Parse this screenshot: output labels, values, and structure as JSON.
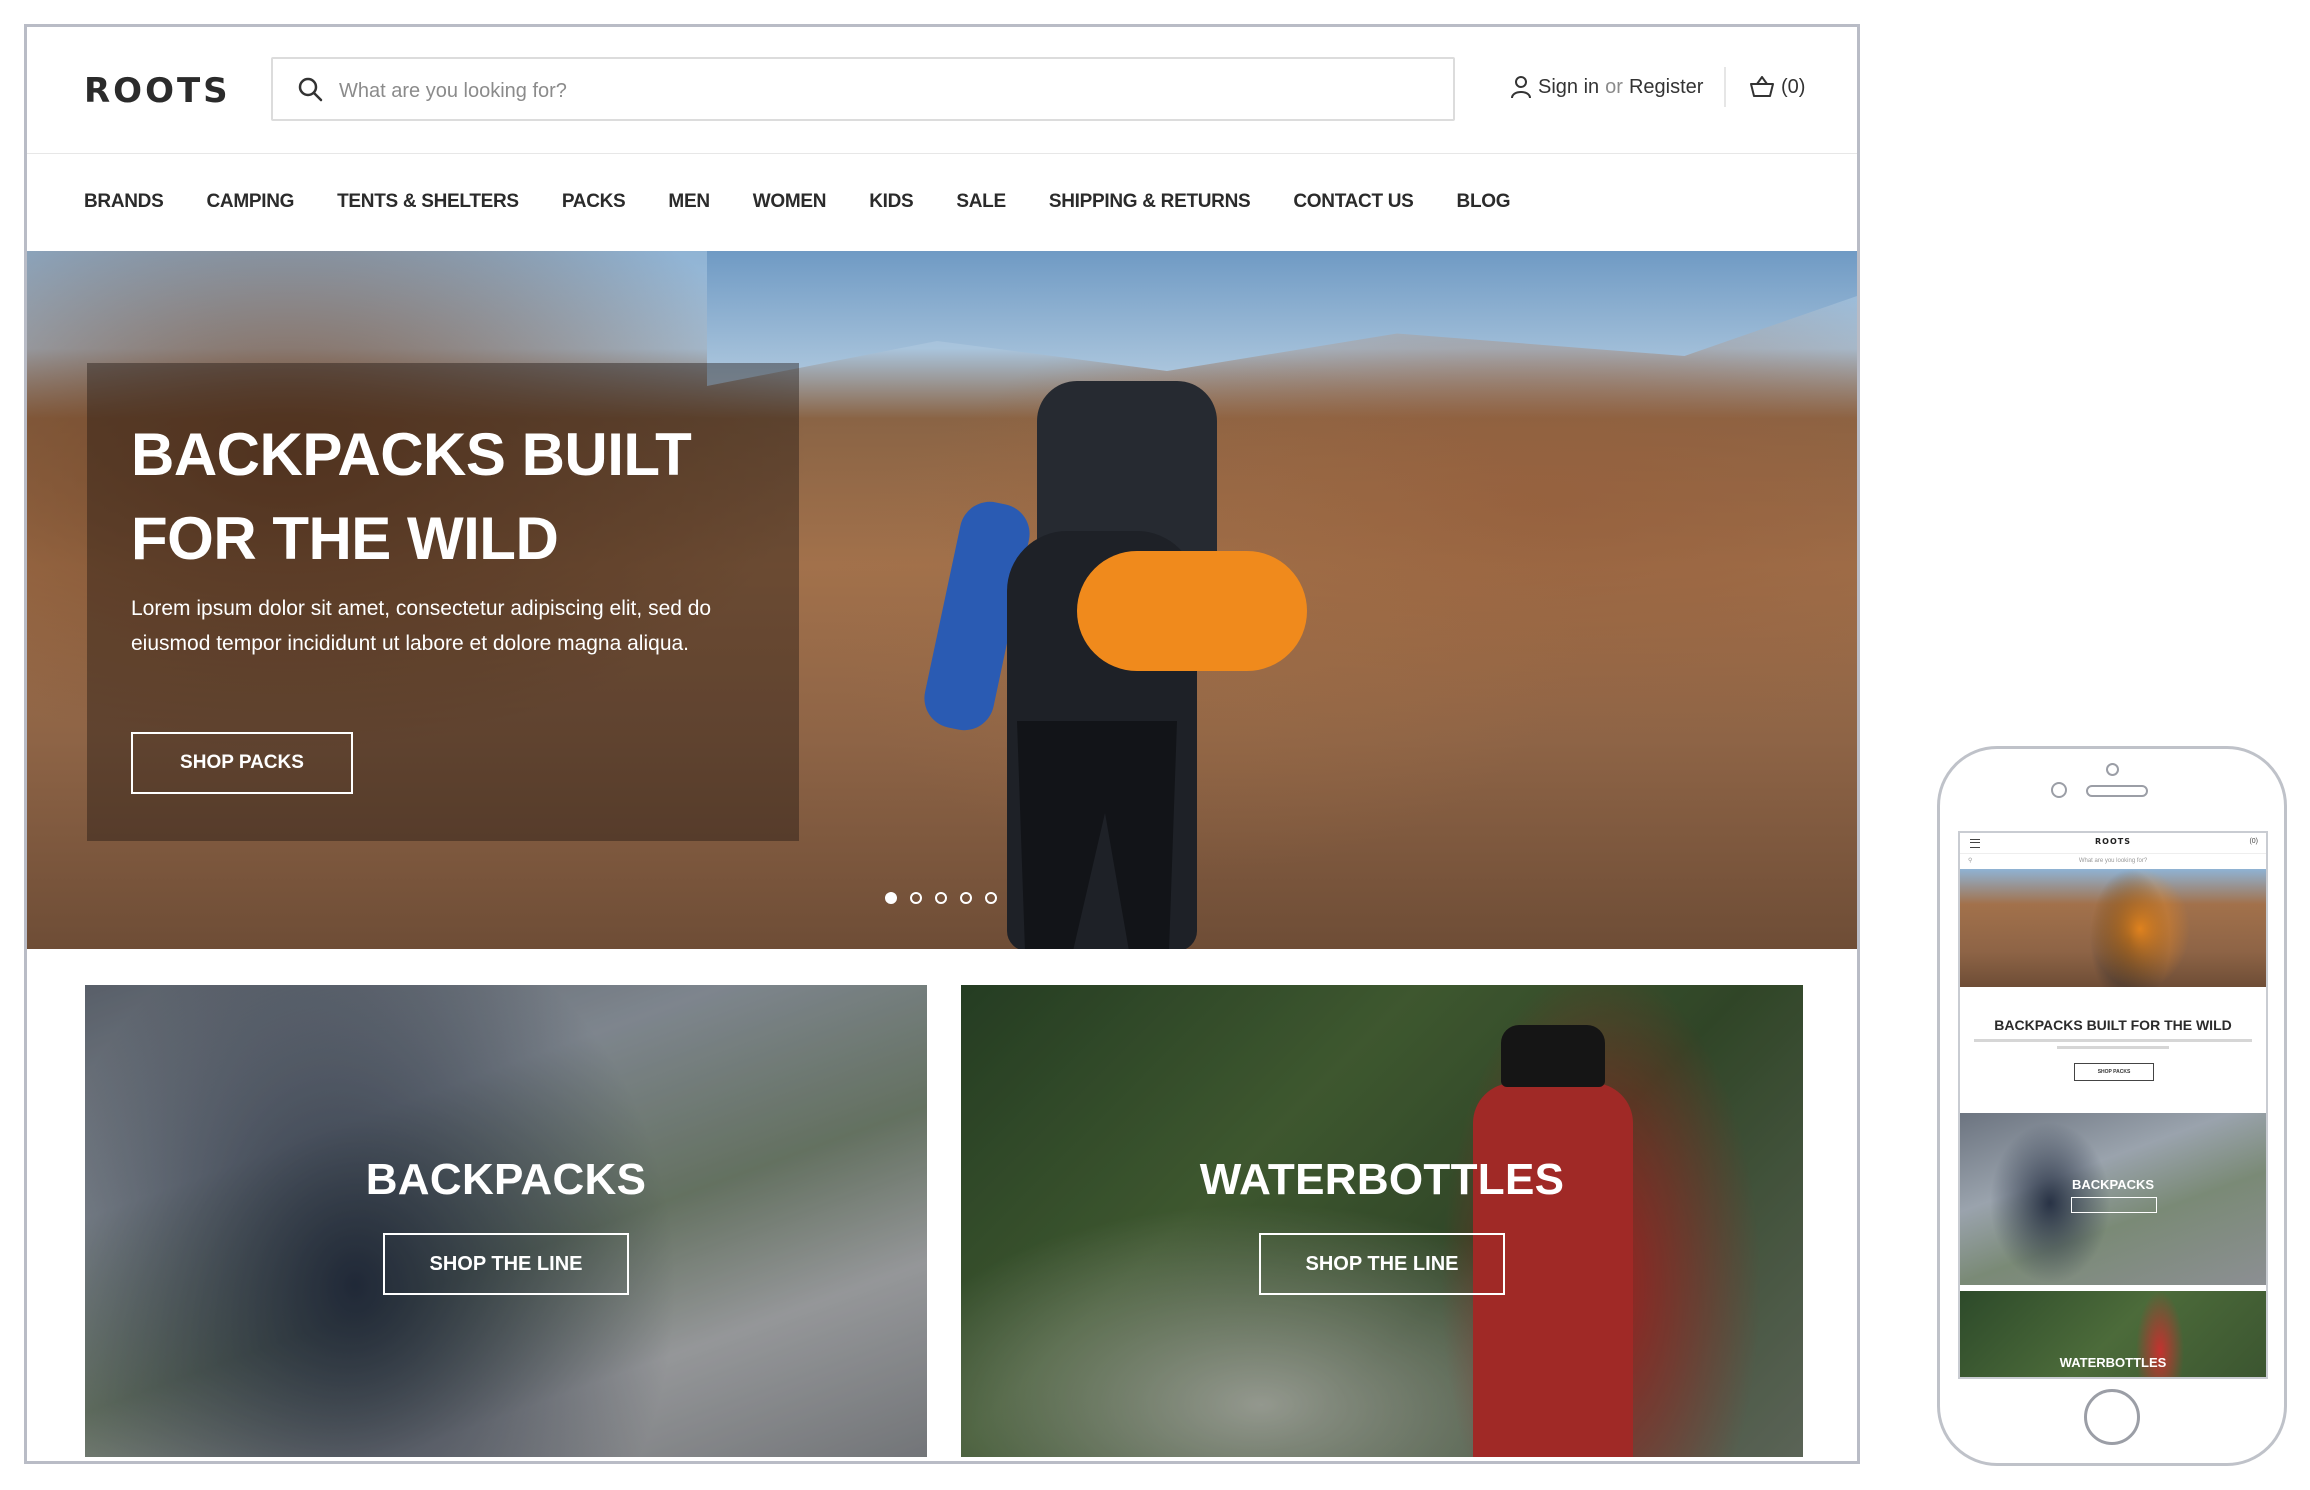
{
  "desktop": {
    "logo": "ROOTS",
    "search": {
      "placeholder": "What are you looking for?"
    },
    "account": {
      "sign_in": "Sign in",
      "or": "or",
      "register": "Register"
    },
    "cart": {
      "count": "(0)"
    },
    "nav": [
      "BRANDS",
      "CAMPING",
      "TENTS & SHELTERS",
      "PACKS",
      "MEN",
      "WOMEN",
      "KIDS",
      "SALE",
      "SHIPPING & RETURNS",
      "CONTACT US",
      "BLOG"
    ],
    "hero": {
      "title": "BACKPACKS BUILT FOR THE WILD",
      "text": "Lorem ipsum dolor sit amet, consectetur adipiscing elit, sed do eiusmod tempor incididunt ut labore et dolore magna aliqua.",
      "button": "SHOP PACKS",
      "slides": 5,
      "active_slide": 1
    },
    "cards": [
      {
        "title": "BACKPACKS",
        "button": "SHOP THE LINE"
      },
      {
        "title": "WATERBOTTLES",
        "button": "SHOP THE LINE"
      }
    ]
  },
  "mobile": {
    "logo": "ROOTS",
    "cart": "(0)",
    "search_placeholder": "What are you looking for?",
    "hero_title": "BACKPACKS BUILT FOR THE WILD",
    "hero_button": "SHOP PACKS",
    "cards": [
      {
        "title": "BACKPACKS"
      },
      {
        "title": "WATERBOTTLES"
      }
    ]
  }
}
